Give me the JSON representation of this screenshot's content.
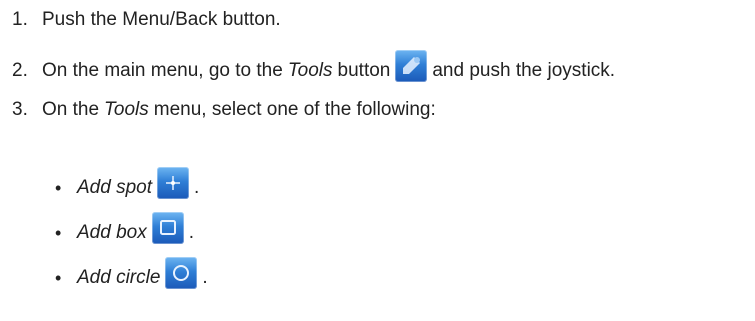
{
  "steps": [
    {
      "number": "1.",
      "text": "Push the Menu/Back button."
    },
    {
      "number": "2.",
      "text_before": "On the main menu, go to the",
      "italic": "Tools",
      "text_middle": "button",
      "text_after": "and push the joystick."
    },
    {
      "number": "3.",
      "text_before": "On the",
      "italic": "Tools",
      "text_after": "menu, select one of the following:"
    }
  ],
  "options": [
    {
      "bullet": "•",
      "label": "Add spot",
      "suffix": ".",
      "icon": "add-spot-icon"
    },
    {
      "bullet": "•",
      "label": "Add box",
      "suffix": ".",
      "icon": "add-box-icon"
    },
    {
      "bullet": "•",
      "label": "Add circle",
      "suffix": ".",
      "icon": "add-circle-icon"
    }
  ],
  "colors": {
    "text": "#222222",
    "icon_blue": "#2f7fd6"
  }
}
